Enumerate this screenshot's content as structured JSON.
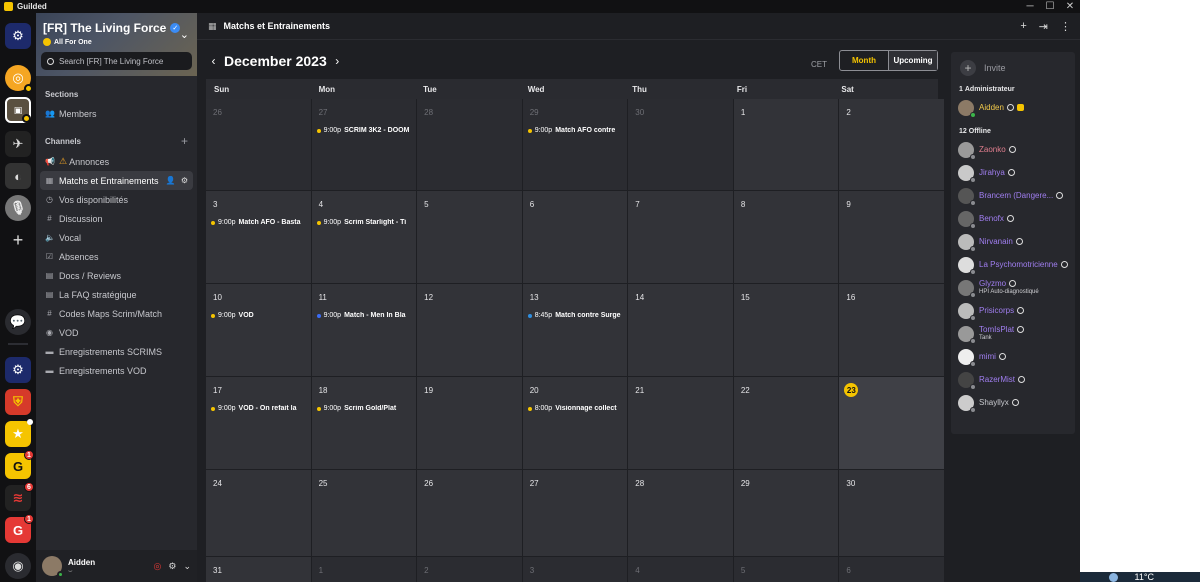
{
  "window": {
    "app_name": "Guilded"
  },
  "taskbar": {
    "temperature": "11°C"
  },
  "rail": {
    "badges": [
      "1",
      "6",
      "1"
    ]
  },
  "server": {
    "name": "[FR] The Living Force",
    "subtitle": "All For One",
    "search_placeholder": "Search [FR] The Living Force"
  },
  "sections": {
    "label": "Sections",
    "items": [
      {
        "label": "Members"
      }
    ]
  },
  "channels": {
    "label": "Channels",
    "items": [
      {
        "label": "Annonces",
        "icon": "megaphone-icon"
      },
      {
        "label": "Matchs et Entrainements",
        "icon": "calendar-icon"
      },
      {
        "label": "Vos disponibilités",
        "icon": "clock-icon"
      },
      {
        "label": "Discussion",
        "icon": "hash-icon"
      },
      {
        "label": "Vocal",
        "icon": "speaker-icon"
      },
      {
        "label": "Absences",
        "icon": "checklist-icon"
      },
      {
        "label": "Docs / Reviews",
        "icon": "doc-icon"
      },
      {
        "label": "La FAQ stratégique",
        "icon": "doc-icon"
      },
      {
        "label": "Codes Maps Scrim/Match",
        "icon": "hash-icon"
      },
      {
        "label": "VOD",
        "icon": "stream-icon"
      },
      {
        "label": "Enregistrements SCRIMS",
        "icon": "folder-icon"
      },
      {
        "label": "Enregistrements VOD",
        "icon": "folder-icon"
      }
    ]
  },
  "user": {
    "name": "Aidden"
  },
  "header": {
    "title": "Matchs et Entrainements"
  },
  "calendar": {
    "month": "December 2023",
    "timezone": "CET",
    "view_month": "Month",
    "view_upcoming": "Upcoming",
    "weekdays": [
      "Sun",
      "Mon",
      "Tue",
      "Wed",
      "Thu",
      "Fri",
      "Sat"
    ],
    "days": [
      {
        "n": "26",
        "other": true
      },
      {
        "n": "27",
        "other": true,
        "ev": {
          "time": "9:00p",
          "name": "SCRIM 3K2 - DOOM",
          "color": "#f5c400"
        }
      },
      {
        "n": "28",
        "other": true
      },
      {
        "n": "29",
        "other": true,
        "ev": {
          "time": "9:00p",
          "name": "Match AFO contre",
          "color": "#f5c400"
        }
      },
      {
        "n": "30",
        "other": true
      },
      {
        "n": "1"
      },
      {
        "n": "2"
      },
      {
        "n": "3",
        "ev": {
          "time": "9:00p",
          "name": "Match AFO - Basta",
          "color": "#f5c400"
        }
      },
      {
        "n": "4",
        "ev": {
          "time": "9:00p",
          "name": "Scrim Starlight - Ti",
          "color": "#f5c400"
        }
      },
      {
        "n": "5"
      },
      {
        "n": "6"
      },
      {
        "n": "7"
      },
      {
        "n": "8"
      },
      {
        "n": "9"
      },
      {
        "n": "10",
        "ev": {
          "time": "9:00p",
          "name": "VOD",
          "color": "#f5c400"
        }
      },
      {
        "n": "11",
        "ev": {
          "time": "9:00p",
          "name": "Match - Men In Bla",
          "color": "#3b6cf5"
        }
      },
      {
        "n": "12"
      },
      {
        "n": "13",
        "ev": {
          "time": "8:45p",
          "name": "Match contre Surge",
          "color": "#2f8fe0"
        }
      },
      {
        "n": "14"
      },
      {
        "n": "15"
      },
      {
        "n": "16"
      },
      {
        "n": "17",
        "ev": {
          "time": "9:00p",
          "name": "VOD - On refait la",
          "color": "#f5c400"
        }
      },
      {
        "n": "18",
        "ev": {
          "time": "9:00p",
          "name": "Scrim Gold/Plat",
          "color": "#f5c400"
        }
      },
      {
        "n": "19"
      },
      {
        "n": "20",
        "ev": {
          "time": "8:00p",
          "name": "Visionnage collect",
          "color": "#f5c400"
        }
      },
      {
        "n": "21"
      },
      {
        "n": "22"
      },
      {
        "n": "23",
        "today": true
      },
      {
        "n": "24"
      },
      {
        "n": "25"
      },
      {
        "n": "26"
      },
      {
        "n": "27"
      },
      {
        "n": "28"
      },
      {
        "n": "29"
      },
      {
        "n": "30"
      },
      {
        "n": "31"
      },
      {
        "n": "1",
        "other": true
      },
      {
        "n": "2",
        "other": true
      },
      {
        "n": "3",
        "other": true
      },
      {
        "n": "4",
        "other": true
      },
      {
        "n": "5",
        "other": true
      },
      {
        "n": "6",
        "other": true
      }
    ]
  },
  "members": {
    "invite_label": "Invite",
    "admin_count": "1",
    "admin_label": "Administrateur",
    "admins": [
      {
        "name": "Aidden",
        "color": "#f0c84a",
        "avatar": "#8c7a66",
        "online": true
      }
    ],
    "offline_count": "12",
    "offline_label": "Offline",
    "offline": [
      {
        "name": "Zaonko",
        "color": "#e07e8e",
        "avatar": "#9a9a9a",
        "status": ""
      },
      {
        "name": "Jirahya",
        "color": "#a07ef0",
        "avatar": "#c9c9c9",
        "status": ""
      },
      {
        "name": "Brancem (Dangere...",
        "color": "#a07ef0",
        "avatar": "#555",
        "status": ""
      },
      {
        "name": "Benofx",
        "color": "#a07ef0",
        "avatar": "#666",
        "status": ""
      },
      {
        "name": "Nirvanain",
        "color": "#a07ef0",
        "avatar": "#bbb",
        "status": ""
      },
      {
        "name": "La Psychomotricienne",
        "color": "#a07ef0",
        "avatar": "#ddd",
        "status": ""
      },
      {
        "name": "Glyzmo",
        "color": "#a07ef0",
        "avatar": "#777",
        "status": "HPI Auto-diagnostiqué"
      },
      {
        "name": "Prisicorps",
        "color": "#a07ef0",
        "avatar": "#bbb",
        "status": ""
      },
      {
        "name": "TomIsPlat",
        "color": "#a07ef0",
        "avatar": "#999",
        "status": "Tank"
      },
      {
        "name": "mimi",
        "color": "#a07ef0",
        "avatar": "#eee",
        "status": ""
      },
      {
        "name": "RazerMist",
        "color": "#a07ef0",
        "avatar": "#444",
        "status": ""
      },
      {
        "name": "Shayllyx",
        "color": "#c8c9ce",
        "avatar": "#ccc",
        "status": ""
      }
    ]
  }
}
